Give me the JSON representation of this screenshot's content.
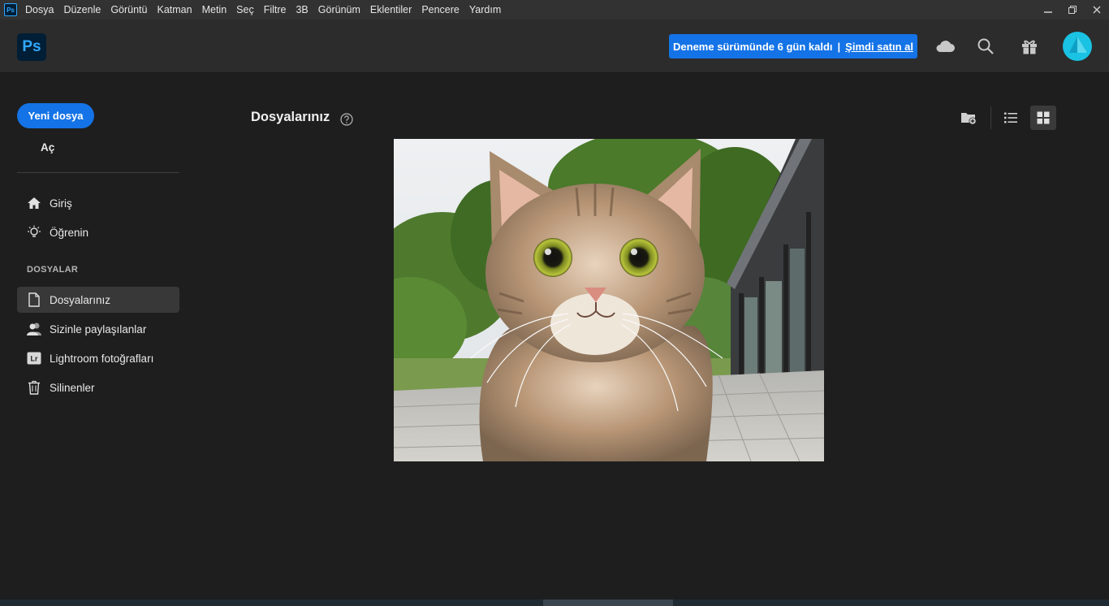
{
  "menubar": {
    "items": [
      "Dosya",
      "Düzenle",
      "Görüntü",
      "Katman",
      "Metin",
      "Seç",
      "Filtre",
      "3B",
      "Görünüm",
      "Eklentiler",
      "Pencere",
      "Yardım"
    ],
    "app_icon_text": "Ps",
    "window_controls": [
      "minimize-icon",
      "restore-icon",
      "close-icon"
    ]
  },
  "appbar": {
    "logo": "Ps",
    "trial_text": "Deneme sürümünde 6 gün kaldı",
    "trial_separator": "|",
    "buy_link": "Şimdi satın al",
    "icons": [
      "cloud-icon",
      "search-icon",
      "gift-icon"
    ]
  },
  "sidebar": {
    "new_file": "Yeni dosya",
    "open": "Aç",
    "nav": [
      {
        "label": "Giriş",
        "icon": "home-icon"
      },
      {
        "label": "Öğrenin",
        "icon": "lightbulb-icon"
      }
    ],
    "section_label": "DOSYALAR",
    "files_nav": [
      {
        "label": "Dosyalarınız",
        "icon": "document-icon",
        "active": true
      },
      {
        "label": "Sizinle paylaşılanlar",
        "icon": "users-icon",
        "active": false
      },
      {
        "label": "Lightroom fotoğrafları",
        "icon": "lightroom-icon",
        "active": false
      },
      {
        "label": "Silinenler",
        "icon": "trash-icon",
        "active": false
      }
    ],
    "lightroom_badge": "Lr"
  },
  "main": {
    "title": "Dosyalarınız",
    "help_icon": "help-icon",
    "toolbar_icons": [
      "new-folder-icon",
      "list-view-icon",
      "grid-view-icon"
    ],
    "selected_view": "grid",
    "thumbnail": "cat-photo-thumbnail"
  },
  "colors": {
    "accent": "#1473e6",
    "background": "#1e1e1e",
    "appbar": "#2c2c2c",
    "menubar": "#323232",
    "ps_blue": "#31a8ff",
    "avatar": "#1ac2e3"
  }
}
